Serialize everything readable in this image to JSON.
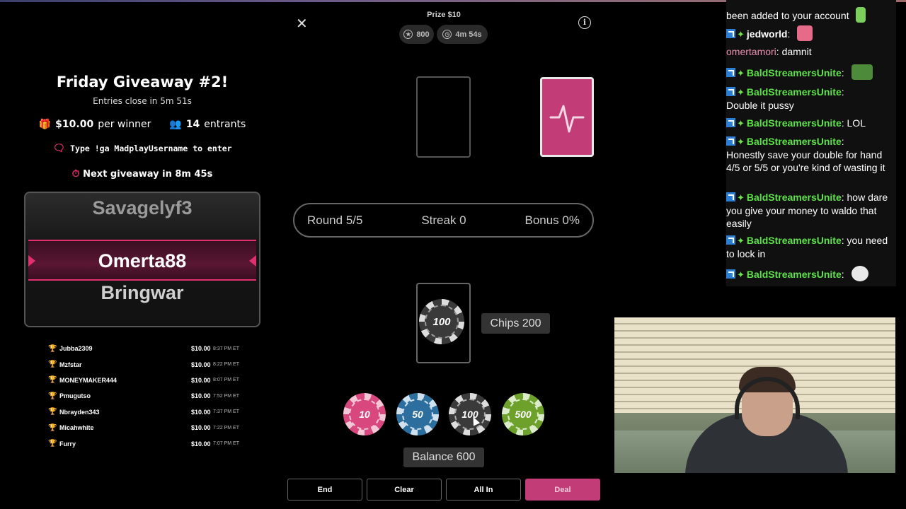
{
  "giveaway": {
    "title": "Friday Giveaway #2!",
    "entries_close": "Entries close in 5m 51s",
    "per_winner_amount": "$10.00",
    "per_winner_label": "per winner",
    "entrants_count": "14",
    "entrants_label": "entrants",
    "command_text": "Type !ga MadplayUsername to enter",
    "next_giveaway": "Next giveaway in 8m 45s",
    "reel": [
      "Savagelyf3",
      "Omerta88",
      "Bringwar"
    ],
    "winners": [
      {
        "name": "Jubba2309",
        "amount": "$10.00",
        "time": "8:37 PM ET"
      },
      {
        "name": "Mzfstar",
        "amount": "$10.00",
        "time": "8:22 PM ET"
      },
      {
        "name": "MONEYMAKER444",
        "amount": "$10.00",
        "time": "8:07 PM ET"
      },
      {
        "name": "Pmugutso",
        "amount": "$10.00",
        "time": "7:52 PM ET"
      },
      {
        "name": "Nbrayden343",
        "amount": "$10.00",
        "time": "7:37 PM ET"
      },
      {
        "name": "Micahwhite",
        "amount": "$10.00",
        "time": "7:22 PM ET"
      },
      {
        "name": "Furry",
        "amount": "$10.00",
        "time": "7:07 PM ET"
      }
    ]
  },
  "game": {
    "prize": "Prize $10",
    "points": "800",
    "timer": "4m 54s",
    "round": "Round 5/5",
    "streak": "Streak 0",
    "bonus": "Bonus 0%",
    "bet_chip": "100",
    "chips_label": "Chips 200",
    "balance_label": "Balance 600",
    "chip_denoms": [
      {
        "value": "10",
        "color": "#d9477f"
      },
      {
        "value": "50",
        "color": "#2c6f9e"
      },
      {
        "value": "100",
        "color": "#3a3a3a"
      },
      {
        "value": "500",
        "color": "#6ea02c"
      }
    ],
    "buttons": {
      "end": "End",
      "clear": "Clear",
      "all_in": "All In",
      "deal": "Deal"
    },
    "card_back_color": "#c23d78"
  },
  "chat": {
    "messages": [
      {
        "user": "",
        "text": "been added to your account"
      },
      {
        "user": "jedworld",
        "text": ""
      },
      {
        "user": "omertamori",
        "text": "damnit"
      },
      {
        "user": "BaldStreamersUnite",
        "text": ""
      },
      {
        "user": "BaldStreamersUnite",
        "text": "Double it pussy"
      },
      {
        "user": "BaldStreamersUnite",
        "text": "LOL"
      },
      {
        "user": "BaldStreamersUnite",
        "text": "Honestly save your double for hand 4/5 or 5/5 or you're kind of wasting it"
      },
      {
        "user": "BaldStreamersUnite",
        "text": "how dare you give your money to waldo that easily"
      },
      {
        "user": "BaldStreamersUnite",
        "text": "you need to lock in"
      },
      {
        "user": "BaldStreamersUnite",
        "text": ""
      }
    ]
  }
}
